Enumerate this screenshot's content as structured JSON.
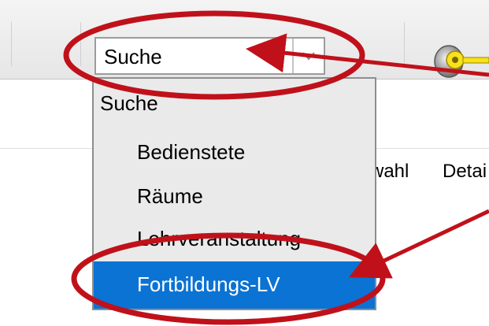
{
  "toolbar": {
    "search_select": {
      "value": "Suche"
    },
    "key_icon": "key-icon"
  },
  "dropdown": {
    "header": "Suche",
    "items": [
      {
        "label": "Bedienstete"
      },
      {
        "label": "Räume"
      },
      {
        "label": "Lehrveranstaltung"
      },
      {
        "label": "Fortbildungs-LV"
      }
    ],
    "selected_index": 3,
    "highlight_color": "#0a73d4"
  },
  "background_tabs": {
    "partial_1": "wahl",
    "partial_2": "Detai"
  },
  "annotations": {
    "color": "#c0111b"
  }
}
